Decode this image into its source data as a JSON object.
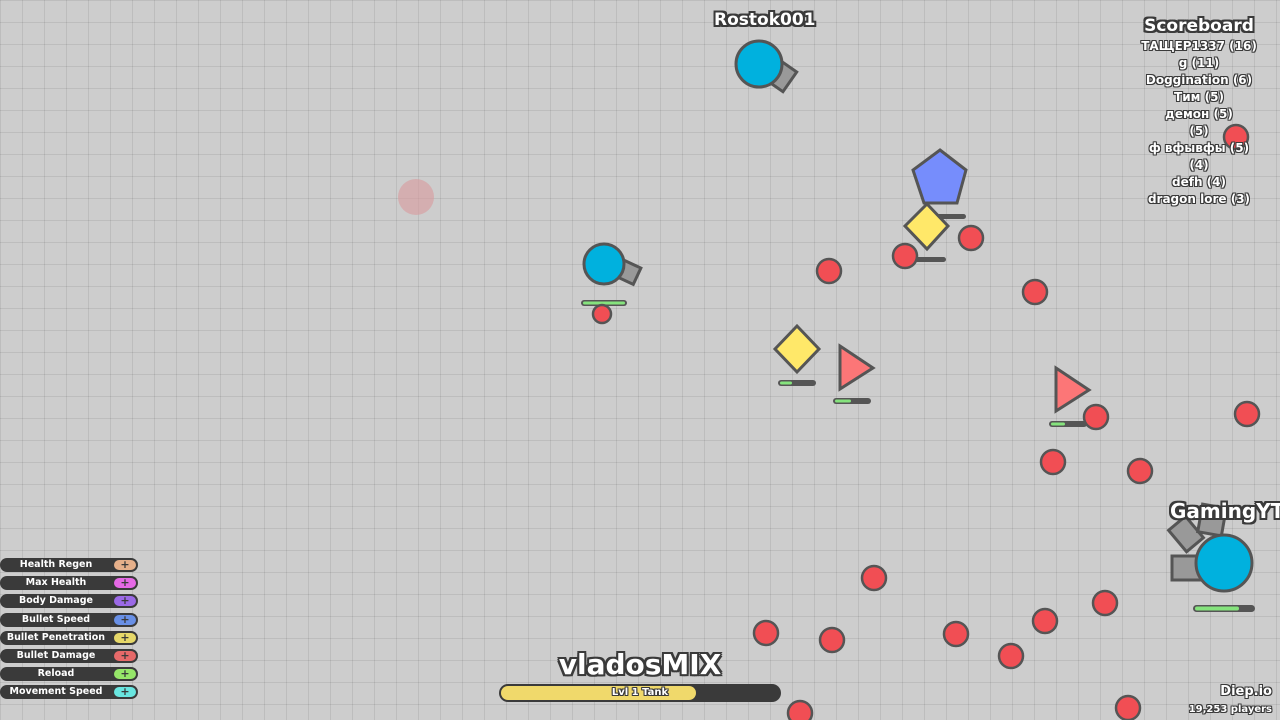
{
  "colors": {
    "background": "#cdcdcd",
    "player_tank": "#00b1de",
    "barrel": "#999999",
    "bullet_enemy": "#f14e54",
    "square": "#ffe869",
    "triangle": "#fc7677",
    "pentagon": "#768dfc",
    "outline": "#555555",
    "health": "#85e37d"
  },
  "names": {
    "rostok": "Rostok001",
    "gaming": "GamingYT",
    "player": "vladosMIX"
  },
  "scoreboard": {
    "title": "Scoreboard",
    "rows": [
      "ТАЩЕР1337 (16)",
      "g (11)",
      "Doggination (6)",
      "Тим (5)",
      "демон (5)",
      "(5)",
      "ф вфывфы (5)",
      "(4)",
      "defh (4)",
      "dragon lore (3)"
    ]
  },
  "upgrades": [
    {
      "label": "Health Regen",
      "color": "#e6b08a"
    },
    {
      "label": "Max Health",
      "color": "#e669e6"
    },
    {
      "label": "Body Damage",
      "color": "#9b69e6"
    },
    {
      "label": "Bullet Speed",
      "color": "#6990e6"
    },
    {
      "label": "Bullet Penetration",
      "color": "#e6d869"
    },
    {
      "label": "Bullet Damage",
      "color": "#e66969"
    },
    {
      "label": "Reload",
      "color": "#96e669"
    },
    {
      "label": "Movement Speed",
      "color": "#69e6e0"
    }
  ],
  "upgrade_plus": "+",
  "xp": {
    "label": "Lvl 1 Tank",
    "progress": 0.7
  },
  "brand": "Diep.io",
  "players": "19,253 players"
}
